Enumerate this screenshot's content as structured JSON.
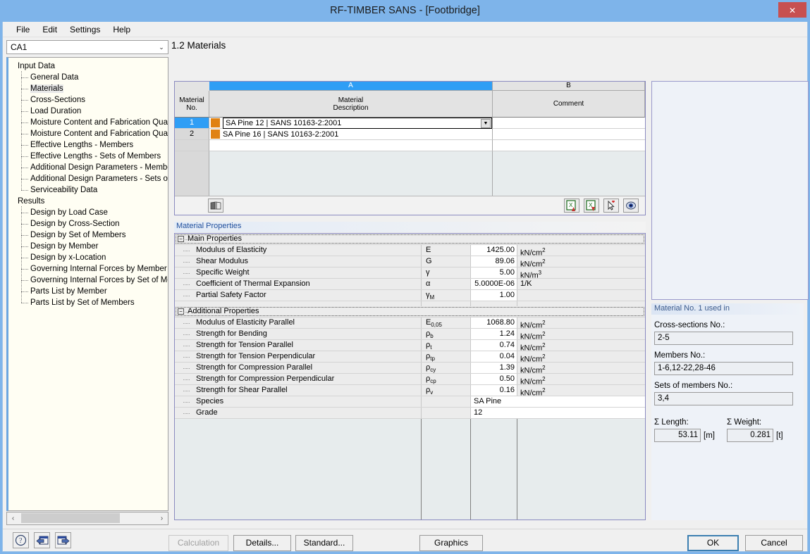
{
  "window": {
    "title": "RF-TIMBER SANS - [Footbridge]",
    "close_label": "✕",
    "titlebar_color": "#7eb4ea",
    "close_color": "#c75050"
  },
  "menubar": {
    "items": [
      "File",
      "Edit",
      "Settings",
      "Help"
    ]
  },
  "sidebar": {
    "combo": {
      "value": "CA1",
      "arrow": "⌄"
    },
    "tree": [
      {
        "label": "Input Data",
        "type": "root"
      },
      {
        "label": "General Data",
        "type": "child"
      },
      {
        "label": "Materials",
        "type": "child",
        "selected": true
      },
      {
        "label": "Cross-Sections",
        "type": "child"
      },
      {
        "label": "Load Duration",
        "type": "child"
      },
      {
        "label": "Moisture Content and Fabrication Quality",
        "type": "child"
      },
      {
        "label": "Moisture Content and Fabrication Quality",
        "type": "child"
      },
      {
        "label": "Effective Lengths - Members",
        "type": "child"
      },
      {
        "label": "Effective Lengths - Sets of Members",
        "type": "child"
      },
      {
        "label": "Additional Design Parameters - Members",
        "type": "child"
      },
      {
        "label": "Additional Design Parameters - Sets of Me",
        "type": "child"
      },
      {
        "label": "Serviceability Data",
        "type": "child",
        "last": true
      },
      {
        "label": "Results",
        "type": "root"
      },
      {
        "label": "Design by Load Case",
        "type": "child"
      },
      {
        "label": "Design by Cross-Section",
        "type": "child"
      },
      {
        "label": "Design by Set of Members",
        "type": "child"
      },
      {
        "label": "Design by Member",
        "type": "child"
      },
      {
        "label": "Design by x-Location",
        "type": "child"
      },
      {
        "label": "Governing Internal Forces by Member",
        "type": "child"
      },
      {
        "label": "Governing Internal Forces by Set of Mem",
        "type": "child"
      },
      {
        "label": "Parts List by Member",
        "type": "child"
      },
      {
        "label": "Parts List by Set of Members",
        "type": "child",
        "last": true
      }
    ],
    "hscroll": {
      "left_arrow": "‹",
      "right_arrow": "›"
    }
  },
  "main": {
    "page_title": "1.2 Materials",
    "materials_table": {
      "col_letters": {
        "a": "A",
        "b": "B"
      },
      "headers": {
        "no_line1": "Material",
        "no_line2": "No.",
        "desc_line1": "Material",
        "desc_line2": "Description",
        "comment": "Comment"
      },
      "rows": [
        {
          "no": "1",
          "description": "SA Pine 12 | SANS 10163-2:2001",
          "comment": "",
          "color": "#e08214",
          "selected": true
        },
        {
          "no": "2",
          "description": "SA Pine 16 | SANS 10163-2:2001",
          "comment": "",
          "color": "#e08214",
          "selected": false
        }
      ],
      "dropdown_arrow": "▼",
      "toolbar": {
        "library_icon": "book-icon",
        "right_icons": [
          "import-material-icon",
          "export-material-icon",
          "pick-material-icon",
          "view-material-icon"
        ]
      }
    },
    "properties": {
      "panel_title": "Material Properties",
      "groups": [
        {
          "name": "Main Properties",
          "expander": "−",
          "rows": [
            {
              "name": "Modulus of Elasticity",
              "symbol": "E",
              "sub": "",
              "value": "1425.00",
              "unit": "kN/cm",
              "unit_sup": "2"
            },
            {
              "name": "Shear Modulus",
              "symbol": "G",
              "sub": "",
              "value": "89.06",
              "unit": "kN/cm",
              "unit_sup": "2"
            },
            {
              "name": "Specific Weight",
              "symbol": "γ",
              "sub": "",
              "value": "5.00",
              "unit": "kN/m",
              "unit_sup": "3"
            },
            {
              "name": "Coefficient of Thermal Expansion",
              "symbol": "α",
              "sub": "",
              "value": "5.0000E-06",
              "unit": "1/K",
              "unit_sup": ""
            },
            {
              "name": "Partial Safety Factor",
              "symbol": "γ",
              "sub": "M",
              "value": "1.00",
              "unit": "",
              "unit_sup": ""
            }
          ]
        },
        {
          "name": "Additional Properties",
          "expander": "−",
          "rows": [
            {
              "name": "Modulus of Elasticity Parallel",
              "symbol": "E",
              "sub": "0,05",
              "value": "1068.80",
              "unit": "kN/cm",
              "unit_sup": "2"
            },
            {
              "name": "Strength for Bending",
              "symbol": "ρ",
              "sub": "b",
              "value": "1.24",
              "unit": "kN/cm",
              "unit_sup": "2"
            },
            {
              "name": "Strength for Tension Parallel",
              "symbol": "ρ",
              "sub": "t",
              "value": "0.74",
              "unit": "kN/cm",
              "unit_sup": "2"
            },
            {
              "name": "Strength for Tension Perpendicular",
              "symbol": "ρ",
              "sub": "tp",
              "value": "0.04",
              "unit": "kN/cm",
              "unit_sup": "2"
            },
            {
              "name": "Strength for Compression Parallel",
              "symbol": "ρ",
              "sub": "cy",
              "value": "1.39",
              "unit": "kN/cm",
              "unit_sup": "2"
            },
            {
              "name": "Strength for Compression Perpendicular",
              "symbol": "ρ",
              "sub": "cp",
              "value": "0.50",
              "unit": "kN/cm",
              "unit_sup": "2"
            },
            {
              "name": "Strength for Shear Parallel",
              "symbol": "ρ",
              "sub": "v",
              "value": "0.16",
              "unit": "kN/cm",
              "unit_sup": "2"
            },
            {
              "name": "Species",
              "symbol": "",
              "sub": "",
              "value": "SA Pine",
              "unit": "",
              "unit_sup": "",
              "text_row": true
            },
            {
              "name": "Grade",
              "symbol": "",
              "sub": "",
              "value": "12",
              "unit": "",
              "unit_sup": "",
              "text_row": true
            }
          ]
        }
      ]
    }
  },
  "right_panel": {
    "used_in_title": "Material No. 1 used in",
    "cross_sections_label": "Cross-sections No.:",
    "cross_sections_value": "2-5",
    "members_label": "Members No.:",
    "members_value": "1-6,12-22,28-46",
    "sets_label": "Sets of members No.:",
    "sets_value": "3,4",
    "length_label": "Σ Length:",
    "length_value": "53.11",
    "length_unit": "[m]",
    "weight_label": "Σ Weight:",
    "weight_value": "0.281",
    "weight_unit": "[t]"
  },
  "footer": {
    "help_icon": "help-question-icon",
    "prev_icon": "previous-window-icon",
    "next_icon": "next-window-icon",
    "calculation_label": "Calculation",
    "details_label": "Details...",
    "standard_label": "Standard...",
    "graphics_label": "Graphics",
    "ok_label": "OK",
    "cancel_label": "Cancel"
  }
}
